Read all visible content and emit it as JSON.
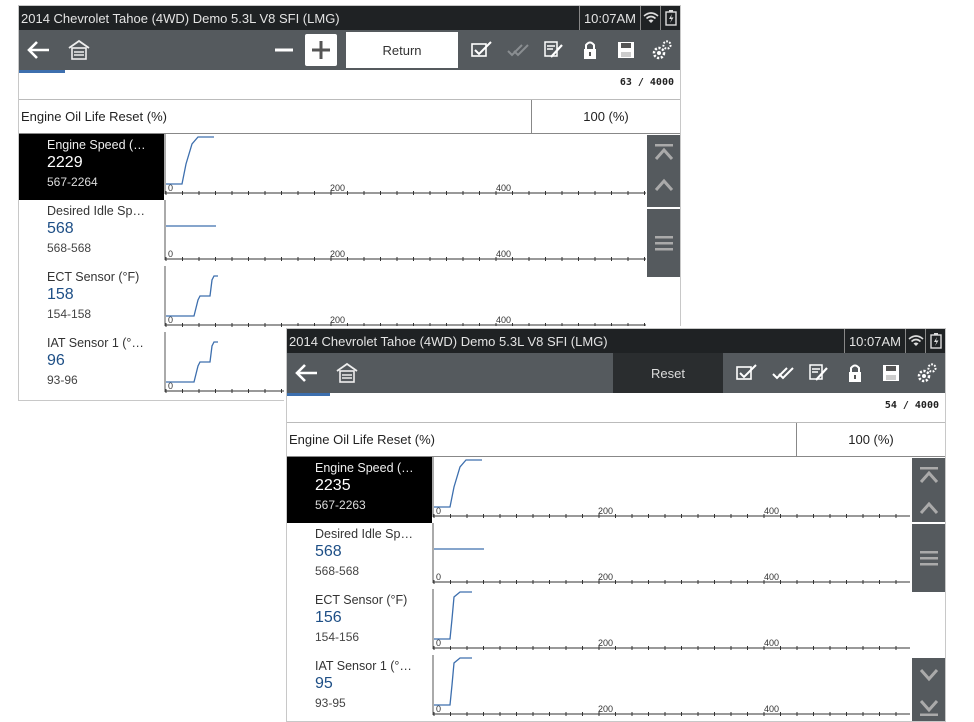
{
  "colors": {
    "titlebar": "#1f2224",
    "toolbar": "#555a5e",
    "accent": "#3d6fae",
    "value_text": "#1e4f86"
  },
  "screen_a": {
    "title": "2014 Chevrolet Tahoe (4WD) Demo 5.3L V8 SFI (LMG)",
    "time": "10:07AM",
    "toolbar": {
      "back": "back-arrow-icon",
      "home": "home-icon",
      "zoom_out": "minus-icon",
      "zoom_in": "plus-icon",
      "return_label": "Return",
      "tools": [
        "check-list-icon",
        "double-check-icon",
        "edit-list-icon",
        "lock-icon",
        "save-icon",
        "settings-gears-icon"
      ]
    },
    "progress": 0.07,
    "counter": "63 / 4000",
    "oil": {
      "label": "Engine Oil Life Reset (%)",
      "value": "100 (%)"
    },
    "pids": [
      {
        "name": "Engine Speed (…",
        "value": "2229",
        "range": "567-2264",
        "selected": true,
        "trace": "step-ramp"
      },
      {
        "name": "Desired Idle Sp…",
        "value": "568",
        "range": "568-568",
        "selected": false,
        "trace": "flat"
      },
      {
        "name": "ECT Sensor (°F)",
        "value": "158",
        "range": "154-158",
        "selected": false,
        "trace": "stairs"
      },
      {
        "name": "IAT Sensor 1 (°…",
        "value": "96",
        "range": "93-96",
        "selected": false,
        "trace": "stairs"
      }
    ],
    "ticks": [
      "0",
      "200",
      "400"
    ]
  },
  "screen_b": {
    "title": "2014 Chevrolet Tahoe (4WD) Demo 5.3L V8 SFI (LMG)",
    "time": "10:07AM",
    "toolbar": {
      "back": "back-arrow-icon",
      "home": "home-icon",
      "reset_label": "Reset",
      "tools": [
        "check-list-icon",
        "double-check-icon",
        "edit-list-icon",
        "lock-icon",
        "save-icon",
        "settings-gears-icon"
      ]
    },
    "progress": 0.065,
    "counter": "54 / 4000",
    "oil": {
      "label": "Engine Oil Life Reset (%)",
      "value": "100 (%)"
    },
    "pids": [
      {
        "name": "Engine Speed (…",
        "value": "2235",
        "range": "567-2263",
        "selected": true,
        "trace": "step-ramp"
      },
      {
        "name": "Desired Idle Sp…",
        "value": "568",
        "range": "568-568",
        "selected": false,
        "trace": "flat"
      },
      {
        "name": "ECT Sensor (°F)",
        "value": "156",
        "range": "154-156",
        "selected": false,
        "trace": "step"
      },
      {
        "name": "IAT Sensor 1 (°…",
        "value": "95",
        "range": "93-95",
        "selected": false,
        "trace": "step"
      }
    ],
    "ticks": [
      "0",
      "200",
      "400"
    ]
  }
}
